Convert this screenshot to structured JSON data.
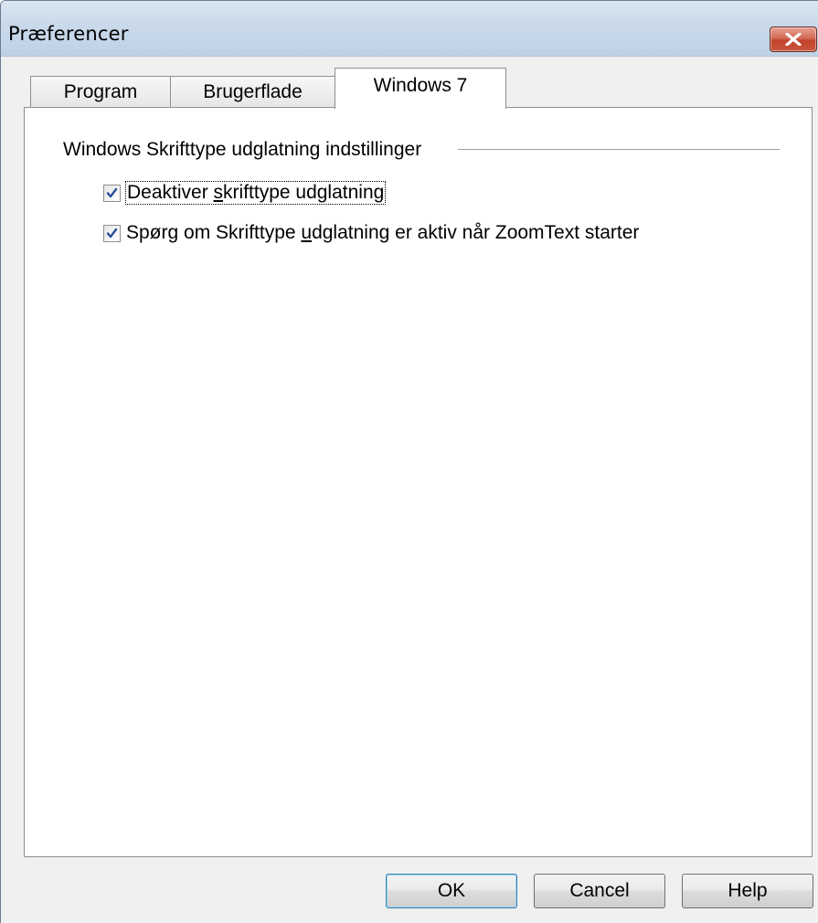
{
  "window": {
    "title": "Præferencer",
    "close_icon": "close-icon"
  },
  "tabs": [
    {
      "label": "Program",
      "active": false
    },
    {
      "label": "Brugerflade",
      "active": false
    },
    {
      "label": "Windows 7",
      "active": true
    }
  ],
  "group": {
    "label": "Windows Skrifttype udglatning indstillinger"
  },
  "checkboxes": [
    {
      "label_before": "Deaktiver ",
      "label_accel": "s",
      "label_after": "krifttype udglatning",
      "checked": true
    },
    {
      "label_before": "Spørg om Skrifttype ",
      "label_accel": "u",
      "label_after": "dglatning er aktiv når ZoomText starter",
      "checked": true
    }
  ],
  "buttons": {
    "ok": "OK",
    "cancel": "Cancel",
    "help": "Help"
  },
  "colors": {
    "titlebar": "#c9d9ea",
    "close_button": "#c9553c",
    "checkmark": "#2a4f9c",
    "default_button_border": "#3c7fb1"
  }
}
